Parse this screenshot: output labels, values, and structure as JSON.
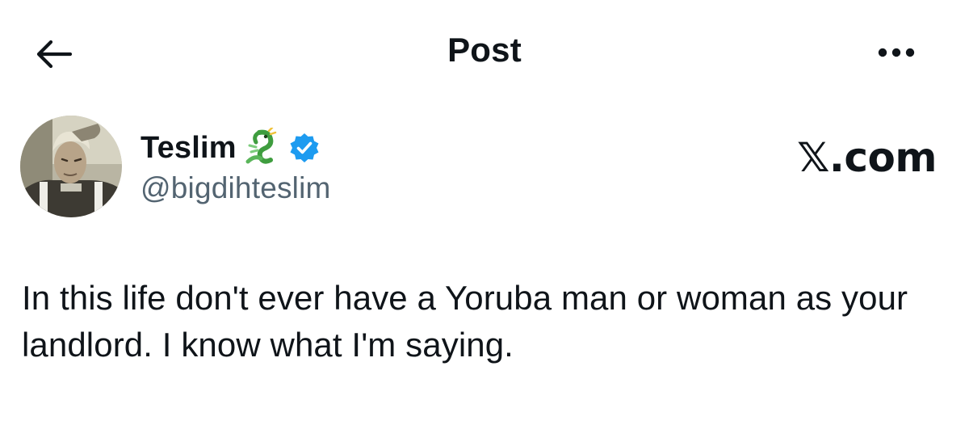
{
  "header": {
    "title": "Post",
    "back_icon": "arrow-left-icon",
    "more_icon": "more-horizontal-icon"
  },
  "author": {
    "display_name": "Teslim",
    "name_emoji": "dragon-emoji",
    "verified_icon": "verified-badge-icon",
    "handle": "@bigdihteslim",
    "avatar": "anime-character-avatar"
  },
  "brand": {
    "text": "𝕏.com"
  },
  "post": {
    "text": "In this life don't ever have a Yoruba man or woman as your landlord. I know what I'm saying."
  },
  "colors": {
    "text_primary": "#0f1419",
    "text_secondary": "#536471",
    "verified_blue": "#1d9bf0",
    "background": "#ffffff"
  }
}
